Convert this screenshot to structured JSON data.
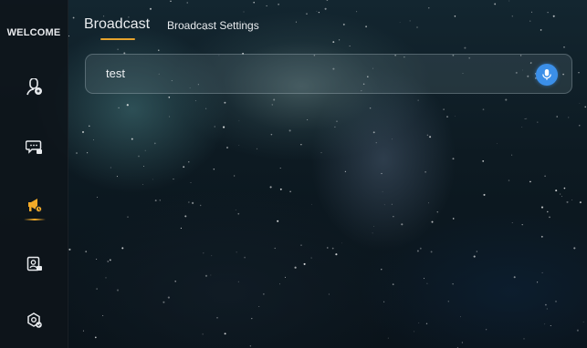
{
  "sidebar": {
    "title": "WELCOME",
    "items": [
      {
        "id": "voice-user",
        "icon": "voice-user-icon",
        "active": false
      },
      {
        "id": "chat",
        "icon": "chat-icon",
        "active": false
      },
      {
        "id": "broadcast",
        "icon": "megaphone-icon",
        "active": true
      },
      {
        "id": "contact-card",
        "icon": "contact-card-icon",
        "active": false
      },
      {
        "id": "settings",
        "icon": "settings-icon",
        "active": false
      }
    ]
  },
  "header": {
    "tabs": [
      {
        "label": "Broadcast",
        "active": true
      },
      {
        "label": "Broadcast Settings",
        "active": false
      }
    ]
  },
  "broadcast": {
    "input_value": "test",
    "mic_icon": "microphone-icon"
  },
  "colors": {
    "accent": "#e6a32d",
    "mic": "#3b8fe8",
    "text": "#e9ecef"
  }
}
